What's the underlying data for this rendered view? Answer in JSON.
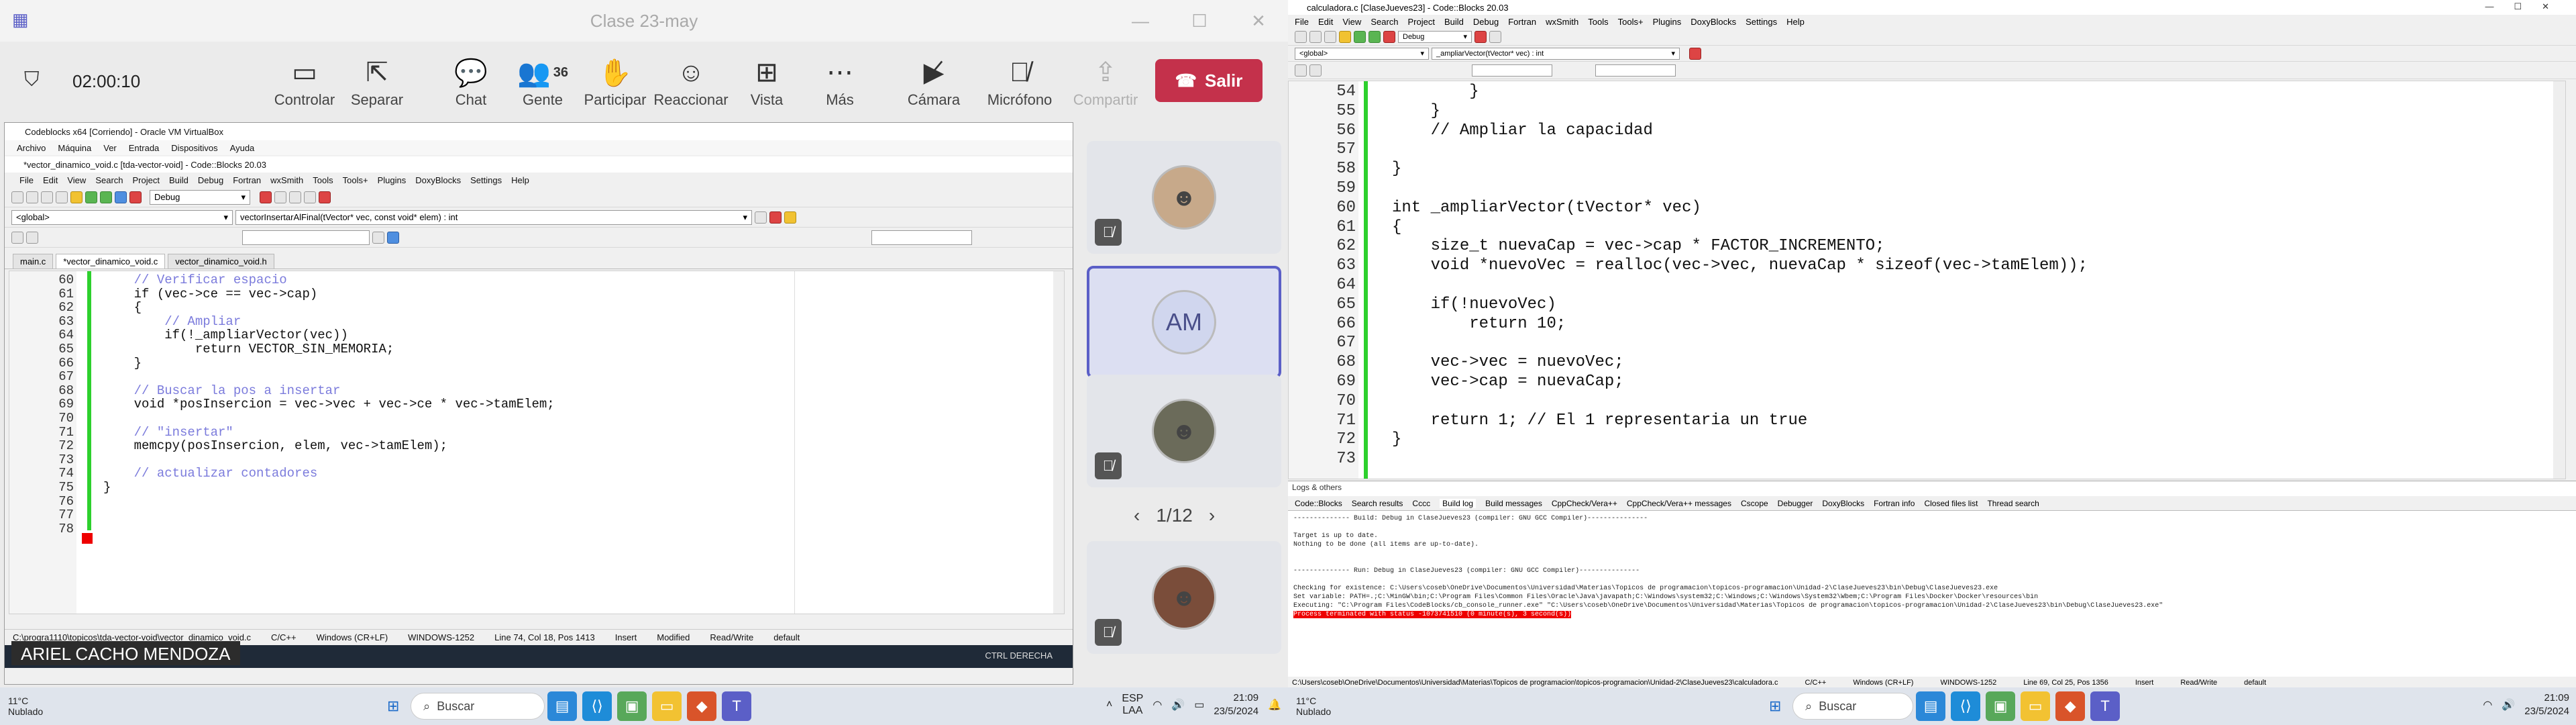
{
  "teams": {
    "window_title": "Clase 23-may",
    "timer": "02:00:10",
    "toolbar": [
      {
        "label": "Controlar",
        "icon": "control-icon"
      },
      {
        "label": "Separar",
        "icon": "popout-icon"
      },
      {
        "label": "Chat",
        "icon": "chat-icon"
      },
      {
        "label": "Gente",
        "icon": "people-icon",
        "count": "36"
      },
      {
        "label": "Participar",
        "icon": "raise-hand-icon"
      },
      {
        "label": "Reaccionar",
        "icon": "react-icon"
      },
      {
        "label": "Vista",
        "icon": "view-icon"
      },
      {
        "label": "Más",
        "icon": "more-icon"
      },
      {
        "label": "Cámara",
        "icon": "camera-off-icon"
      },
      {
        "label": "Micrófono",
        "icon": "mic-off-icon"
      },
      {
        "label": "Compartir",
        "icon": "share-icon"
      }
    ],
    "leave_label": "Salir",
    "speaker_name": "ARIEL CACHO MENDOZA",
    "tile_initials": "AM",
    "pager": "1/12"
  },
  "vm": {
    "title": "Codeblocks x64 [Corriendo] - Oracle VM VirtualBox",
    "menu": [
      "Archivo",
      "Máquina",
      "Ver",
      "Entrada",
      "Dispositivos",
      "Ayuda"
    ],
    "cb_title": "*vector_dinamico_void.c [tda-vector-void] - Code::Blocks 20.03",
    "cb_menu": [
      "File",
      "Edit",
      "View",
      "Search",
      "Project",
      "Build",
      "Debug",
      "Fortran",
      "wxSmith",
      "Tools",
      "Tools+",
      "Plugins",
      "DoxyBlocks",
      "Settings",
      "Help"
    ],
    "scope": "<global>",
    "function": "vectorInsertarAlFinal(tVector* vec, const void* elem) : int",
    "build_target": "Debug",
    "tabs": [
      "main.c",
      "*vector_dinamico_void.c",
      "vector_dinamico_void.h"
    ],
    "lines": [
      {
        "n": "60",
        "t": "    // Verificar espacio"
      },
      {
        "n": "61",
        "t": "    if (vec->ce == vec->cap)"
      },
      {
        "n": "62",
        "t": "    {"
      },
      {
        "n": "63",
        "t": "        // Ampliar"
      },
      {
        "n": "64",
        "t": "        if(!_ampliarVector(vec))"
      },
      {
        "n": "65",
        "t": "            return VECTOR_SIN_MEMORIA;"
      },
      {
        "n": "66",
        "t": "    }"
      },
      {
        "n": "67",
        "t": ""
      },
      {
        "n": "68",
        "t": "    // Buscar la pos a insertar"
      },
      {
        "n": "69",
        "t": "    void *posInsercion = vec->vec + vec->ce * vec->tamElem;"
      },
      {
        "n": "70",
        "t": ""
      },
      {
        "n": "71",
        "t": "    // \"insertar\""
      },
      {
        "n": "72",
        "t": "    memcpy(posInsercion, elem, vec->tamElem);"
      },
      {
        "n": "73",
        "t": ""
      },
      {
        "n": "74",
        "t": "    // actualizar contadores"
      },
      {
        "n": "75",
        "t": "}"
      },
      {
        "n": "76",
        "t": ""
      },
      {
        "n": "77",
        "t": ""
      },
      {
        "n": "78",
        "t": ""
      }
    ],
    "status": {
      "path": "C:\\progra1110\\topicos\\tda-vector-void\\vector_dinamico_void.c",
      "lang": "C/C++",
      "eol": "Windows (CR+LF)",
      "enc": "WINDOWS-1252",
      "pos": "Line 74, Col 18, Pos 1413",
      "mode": "Insert",
      "modified": "Modified",
      "rw": "Read/Write",
      "profile": "default"
    },
    "host_key": "CTRL DERECHA"
  },
  "taskbar_left": {
    "temp": "11°C",
    "weather": "Nublado",
    "search": "Buscar",
    "lang": "ESP",
    "region": "LAA",
    "time": "21:09",
    "date": "23/5/2024"
  },
  "cb2": {
    "title": "calculadora.c [ClaseJueves23] - Code::Blocks 20.03",
    "menu": [
      "File",
      "Edit",
      "View",
      "Search",
      "Project",
      "Build",
      "Debug",
      "Fortran",
      "wxSmith",
      "Tools",
      "Tools+",
      "Plugins",
      "DoxyBlocks",
      "Settings",
      "Help"
    ],
    "scope": "<global>",
    "function": "_ampliarVector(tVector* vec) : int",
    "build_target": "Debug",
    "lines": [
      {
        "n": "54",
        "t": "        }"
      },
      {
        "n": "55",
        "t": "    }"
      },
      {
        "n": "56",
        "t": "    // Ampliar la capacidad"
      },
      {
        "n": "57",
        "t": ""
      },
      {
        "n": "58",
        "t": "}"
      },
      {
        "n": "59",
        "t": ""
      },
      {
        "n": "60",
        "t": "int _ampliarVector(tVector* vec)"
      },
      {
        "n": "61",
        "t": "{"
      },
      {
        "n": "62",
        "t": "    size_t nuevaCap = vec->cap * FACTOR_INCREMENTO;"
      },
      {
        "n": "63",
        "t": "    void *nuevoVec = realloc(vec->vec, nuevaCap * sizeof(vec->tamElem));"
      },
      {
        "n": "64",
        "t": ""
      },
      {
        "n": "65",
        "t": "    if(!nuevoVec)"
      },
      {
        "n": "66",
        "t": "        return 10;"
      },
      {
        "n": "67",
        "t": ""
      },
      {
        "n": "68",
        "t": "    vec->vec = nuevoVec;"
      },
      {
        "n": "69",
        "t": "    vec->cap = nuevaCap;"
      },
      {
        "n": "70",
        "t": ""
      },
      {
        "n": "71",
        "t": "    return 1; // El 1 representaria un true"
      },
      {
        "n": "72",
        "t": "}"
      },
      {
        "n": "73",
        "t": ""
      }
    ],
    "logs_header": "Logs & others",
    "logs_tabs": [
      "Code::Blocks",
      "Search results",
      "Cccc",
      "Build log",
      "Build messages",
      "CppCheck/Vera++",
      "CppCheck/Vera++ messages",
      "Cscope",
      "Debugger",
      "DoxyBlocks",
      "Fortran info",
      "Closed files list",
      "Thread search"
    ],
    "log_lines": [
      "-------------- Build: Debug in ClaseJueves23 (compiler: GNU GCC Compiler)---------------",
      "",
      "Target is up to date.",
      "Nothing to be done (all items are up-to-date).",
      "",
      "",
      "-------------- Run: Debug in ClaseJueves23 (compiler: GNU GCC Compiler)---------------",
      "",
      "Checking for existence: C:\\Users\\coseb\\OneDrive\\Documentos\\Universidad\\Materias\\Topicos de programacion\\topicos-programacion\\Unidad-2\\ClaseJueves23\\bin\\Debug\\ClaseJueves23.exe",
      "Set variable: PATH=.;C:\\MinGW\\bin;C:\\Program Files\\Common Files\\Oracle\\Java\\javapath;C:\\Windows\\system32;C:\\Windows;C:\\Windows\\System32\\Wbem;C:\\Program Files\\Docker\\Docker\\resources\\bin",
      "Executing: \"C:\\Program Files\\CodeBlocks/cb_console_runner.exe\" \"C:\\Users\\coseb\\OneDrive\\Documentos\\Universidad\\Materias\\Topicos de programacion\\topicos-programacion\\Unidad-2\\ClaseJueves23\\bin\\Debug\\ClaseJueves23.exe\"",
      "Process terminated with status -1073741510 (0 minute(s), 3 second(s))"
    ],
    "status": {
      "path": "C:\\Users\\coseb\\OneDrive\\Documentos\\Universidad\\Materias\\Topicos de programacion\\topicos-programacion\\Unidad-2\\ClaseJueves23\\calculadora.c",
      "lang": "C/C++",
      "eol": "Windows (CR+LF)",
      "enc": "WINDOWS-1252",
      "pos": "Line 69, Col 25, Pos 1356",
      "mode": "Insert",
      "rw": "Read/Write",
      "profile": "default"
    }
  },
  "taskbar_right": {
    "temp": "11°C",
    "weather": "Nublado",
    "search": "Buscar",
    "time": "21:09",
    "date": "23/5/2024"
  }
}
